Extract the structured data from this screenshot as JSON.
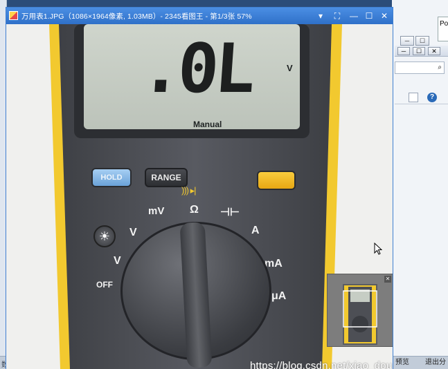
{
  "viewer": {
    "title": "万用表1.JPG（1086×1964像素, 1.03MB）- 2345看图王 - 第1/3张 57%",
    "controls": {
      "menu": "▾",
      "fullscreen": "⛶",
      "minimize": "—",
      "maximize": "☐",
      "close": "✕"
    }
  },
  "meter": {
    "display_text": ".0L",
    "display_mode": "Manual",
    "display_unit": "V",
    "hold_label": "HOLD",
    "range_label": "RANGE",
    "dial": {
      "off": "OFF",
      "v_ac": "V",
      "v_dc": "V",
      "mv": "mV",
      "ohm": "Ω",
      "amp": "A",
      "ma": "mA",
      "ua": "μA"
    }
  },
  "navigator": {
    "close": "✕"
  },
  "watermark": "https://blog.csdn.net/xiao_dou_ya_cool",
  "background": {
    "right_panel_label": "Po",
    "bottom_left": "数据",
    "bottom_tabs": [
      "预览",
      "退出分"
    ]
  },
  "colors": {
    "titlebar": "#3a7fd6",
    "meter_body": "#4d4f55",
    "meter_holster": "#f2c92f",
    "display_bg": "#c6cdc4",
    "yellow_button": "#f4b81d",
    "hold_button": "#7db4e8"
  }
}
